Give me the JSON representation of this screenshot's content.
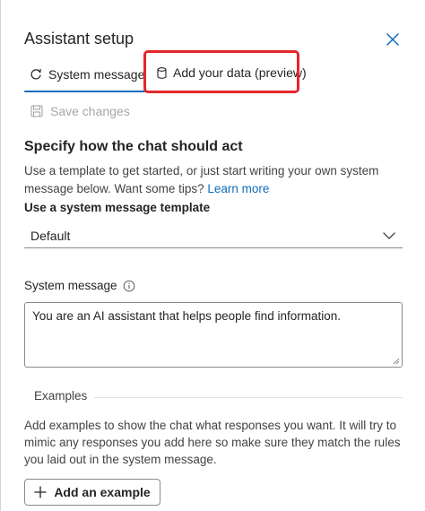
{
  "panel": {
    "title": "Assistant setup",
    "close_icon": "close-icon"
  },
  "tabs": [
    {
      "label": "System message",
      "icon": "chat-refresh-icon",
      "selected": true
    },
    {
      "label": "Add your data (preview)",
      "icon": "database-icon",
      "selected": false
    }
  ],
  "toolbar": {
    "save_label": "Save changes",
    "save_icon": "save-icon",
    "save_enabled": false
  },
  "section": {
    "heading": "Specify how the chat should act",
    "description": "Use a template to get started, or just start writing your own system message below. Want some tips?",
    "link_text": "Learn more"
  },
  "template": {
    "label": "Use a system message template",
    "selected": "Default"
  },
  "system_message": {
    "label": "System message",
    "value": "You are an AI assistant that helps people find information."
  },
  "examples": {
    "label": "Examples",
    "description": "Add examples to show the chat what responses you want. It will try to mimic any responses you add here so make sure they match the rules you laid out in the system message.",
    "add_button_label": "Add an example"
  },
  "colors": {
    "accent": "#0f6cbd",
    "highlight_box": "#e4262b",
    "disabled_text": "#a6a6a6"
  }
}
